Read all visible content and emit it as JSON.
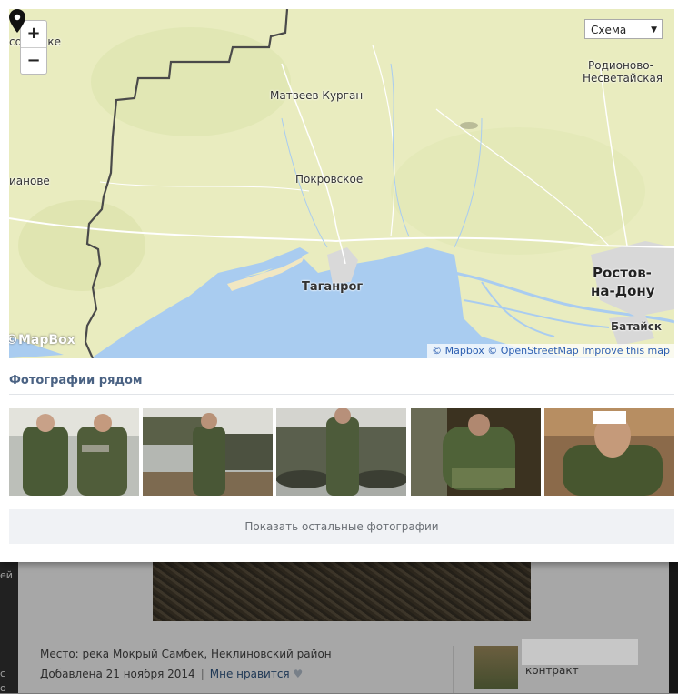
{
  "map": {
    "zoom_in": "+",
    "zoom_out": "−",
    "layer_select": "Схема",
    "cities": [
      {
        "label": "Матвеев Курган"
      },
      {
        "label": "Покровское"
      },
      {
        "label": "Таганрог"
      },
      {
        "label": "Родионово-"
      },
      {
        "label": "Несветайская"
      },
      {
        "label": "Ростов-"
      },
      {
        "label": "на-Дону"
      },
      {
        "label": "Батайск"
      },
      {
        "label": "сольське"
      },
      {
        "label": "ианове"
      }
    ],
    "logo": "©MapBox",
    "attribution": {
      "mapbox": "© Mapbox",
      "osm": "© OpenStreetMap",
      "improve": "Improve this map"
    }
  },
  "nearby": {
    "title": "Фотографии рядом",
    "more_button": "Показать остальные фотографии"
  },
  "background_post": {
    "place": "Место: река Мокрый Самбек, Неклиновский район",
    "added": "Добавлена 21 ноября 2014",
    "separator": "|",
    "like": "Мне нравится",
    "status": "контракт",
    "left_fragments": [
      "ей",
      "с",
      "о"
    ]
  },
  "colors": {
    "land": "#e9ecbf",
    "water": "#a9ccf0",
    "border": "#4a4a4a",
    "title": "#4a6283",
    "link": "#2a5db0"
  }
}
